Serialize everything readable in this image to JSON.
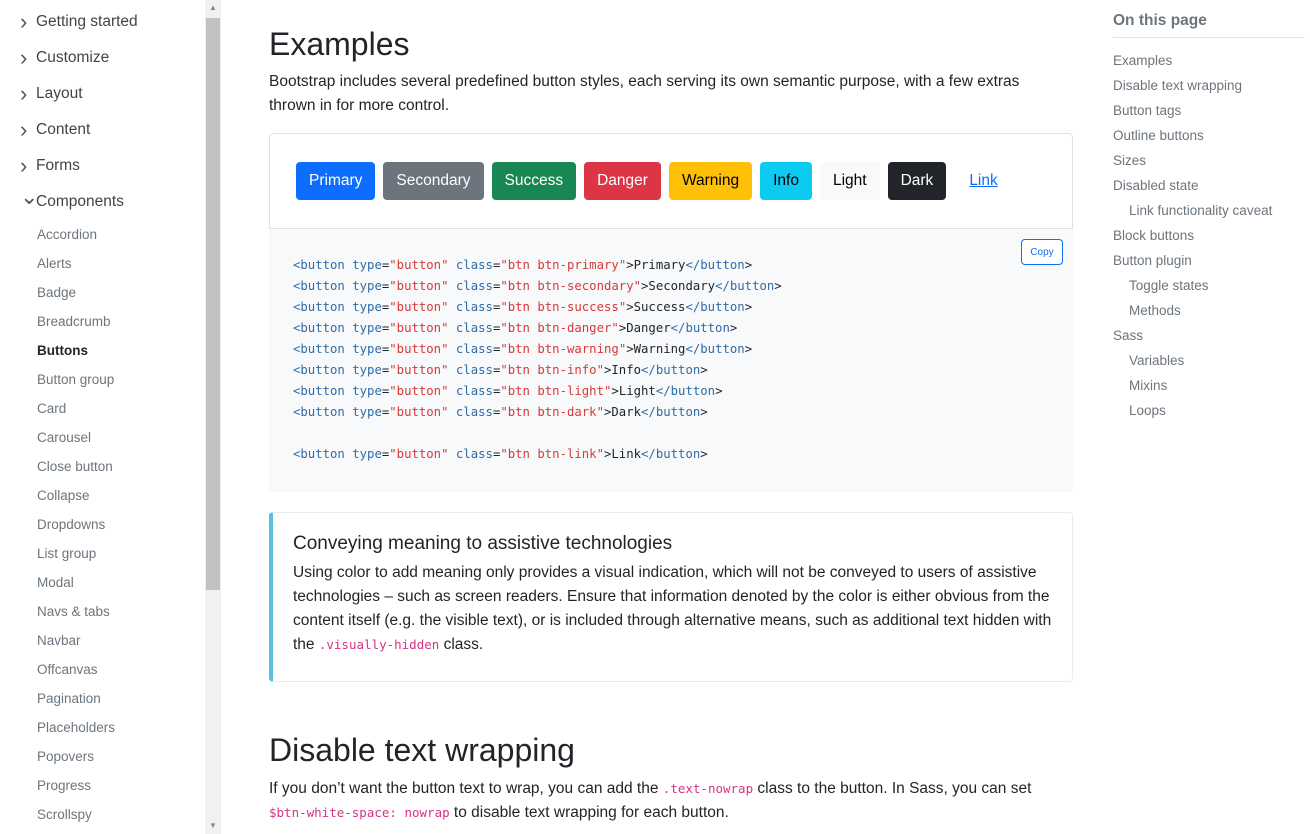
{
  "sidebar": {
    "sections": [
      {
        "label": "Getting started",
        "expanded": false
      },
      {
        "label": "Customize",
        "expanded": false
      },
      {
        "label": "Layout",
        "expanded": false
      },
      {
        "label": "Content",
        "expanded": false
      },
      {
        "label": "Forms",
        "expanded": false
      },
      {
        "label": "Components",
        "expanded": true
      }
    ],
    "items": [
      "Accordion",
      "Alerts",
      "Badge",
      "Breadcrumb",
      "Buttons",
      "Button group",
      "Card",
      "Carousel",
      "Close button",
      "Collapse",
      "Dropdowns",
      "List group",
      "Modal",
      "Navs & tabs",
      "Navbar",
      "Offcanvas",
      "Pagination",
      "Placeholders",
      "Popovers",
      "Progress",
      "Scrollspy"
    ],
    "active": "Buttons"
  },
  "main": {
    "title": "Examples",
    "lead": "Bootstrap includes several predefined button styles, each serving its own semantic purpose, with a few extras thrown in for more control.",
    "buttons": [
      {
        "label": "Primary",
        "bg": "#0d6efd",
        "fg": "#ffffff"
      },
      {
        "label": "Secondary",
        "bg": "#6c757d",
        "fg": "#ffffff"
      },
      {
        "label": "Success",
        "bg": "#198754",
        "fg": "#ffffff"
      },
      {
        "label": "Danger",
        "bg": "#dc3545",
        "fg": "#ffffff"
      },
      {
        "label": "Warning",
        "bg": "#ffc107",
        "fg": "#000000"
      },
      {
        "label": "Info",
        "bg": "#0dcaf0",
        "fg": "#000000"
      },
      {
        "label": "Light",
        "bg": "#f8f9fa",
        "fg": "#000000"
      },
      {
        "label": "Dark",
        "bg": "#212529",
        "fg": "#ffffff"
      },
      {
        "label": "Link",
        "bg": "transparent",
        "fg": "#0d6efd"
      }
    ],
    "copy_label": "Copy",
    "code_lines": [
      [
        "btn btn-primary",
        "Primary"
      ],
      [
        "btn btn-secondary",
        "Secondary"
      ],
      [
        "btn btn-success",
        "Success"
      ],
      [
        "btn btn-danger",
        "Danger"
      ],
      [
        "btn btn-warning",
        "Warning"
      ],
      [
        "btn btn-info",
        "Info"
      ],
      [
        "btn btn-light",
        "Light"
      ],
      [
        "btn btn-dark",
        "Dark"
      ],
      null,
      [
        "btn btn-link",
        "Link"
      ]
    ],
    "callout": {
      "title": "Conveying meaning to assistive technologies",
      "text": "Using color to add meaning only provides a visual indication, which will not be conveyed to users of assistive technologies – such as screen readers. Ensure that information denoted by the color is either obvious from the content itself (e.g. the visible text), or is included through alternative means, such as additional text hidden with the ",
      "code": ".visually-hidden",
      "text_end": " class."
    },
    "section2": {
      "title": "Disable text wrapping",
      "t1": "If you don’t want the button text to wrap, you can add the ",
      "c1": ".text-nowrap",
      "t2": " class to the button. In Sass, you can set ",
      "c2": "$btn-white-space: nowrap",
      "t3": " to disable text wrapping for each button."
    }
  },
  "toc": {
    "title": "On this page",
    "items": [
      {
        "label": "Examples",
        "indent": false
      },
      {
        "label": "Disable text wrapping",
        "indent": false
      },
      {
        "label": "Button tags",
        "indent": false
      },
      {
        "label": "Outline buttons",
        "indent": false
      },
      {
        "label": "Sizes",
        "indent": false
      },
      {
        "label": "Disabled state",
        "indent": false
      },
      {
        "label": "Link functionality caveat",
        "indent": true
      },
      {
        "label": "Block buttons",
        "indent": false
      },
      {
        "label": "Button plugin",
        "indent": false
      },
      {
        "label": "Toggle states",
        "indent": true
      },
      {
        "label": "Methods",
        "indent": true
      },
      {
        "label": "Sass",
        "indent": false
      },
      {
        "label": "Variables",
        "indent": true
      },
      {
        "label": "Mixins",
        "indent": true
      },
      {
        "label": "Loops",
        "indent": true
      }
    ]
  }
}
